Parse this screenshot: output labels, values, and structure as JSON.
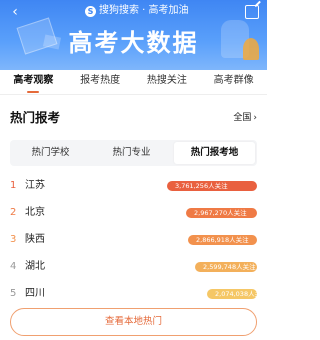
{
  "header": {
    "brand": "搜狗搜索 · 高考加油",
    "logo_glyph": "S",
    "title": "高考大数据",
    "back_glyph": "‹",
    "gradient_top": "#3f86f3",
    "gradient_bottom": "#7fb6fb"
  },
  "tabs": [
    {
      "label": "高考观察",
      "active": true
    },
    {
      "label": "报考热度",
      "active": false
    },
    {
      "label": "热搜关注",
      "active": false
    },
    {
      "label": "高考群像",
      "active": false
    }
  ],
  "section": {
    "title": "热门报考",
    "link_label": "全国",
    "link_chevron": "›"
  },
  "subtabs": [
    {
      "label": "热门学校",
      "active": false
    },
    {
      "label": "热门专业",
      "active": false
    },
    {
      "label": "热门报考地",
      "active": true
    }
  ],
  "ranking": [
    {
      "rank": "1",
      "name": "江苏",
      "value_text": "3,761,256人关注",
      "value": 3761256,
      "color": "#e9603f",
      "rank_color": "#e9603f"
    },
    {
      "rank": "2",
      "name": "北京",
      "value_text": "2,967,270人关注",
      "value": 2967270,
      "color": "#ef7a45",
      "rank_color": "#ef7a45"
    },
    {
      "rank": "3",
      "name": "陕西",
      "value_text": "2,866,918人关注",
      "value": 2866918,
      "color": "#f2914d",
      "rank_color": "#f2914d"
    },
    {
      "rank": "4",
      "name": "湖北",
      "value_text": "2,599,748人关注",
      "value": 2599748,
      "color": "#f3b05b",
      "rank_color": "#999999"
    },
    {
      "rank": "5",
      "name": "四川",
      "value_text": "2,074,038人关注",
      "value": 2074038,
      "color": "#f5c766",
      "rank_color": "#999999"
    }
  ],
  "footer_button": "查看本地热门",
  "accent": "#e56a3a"
}
